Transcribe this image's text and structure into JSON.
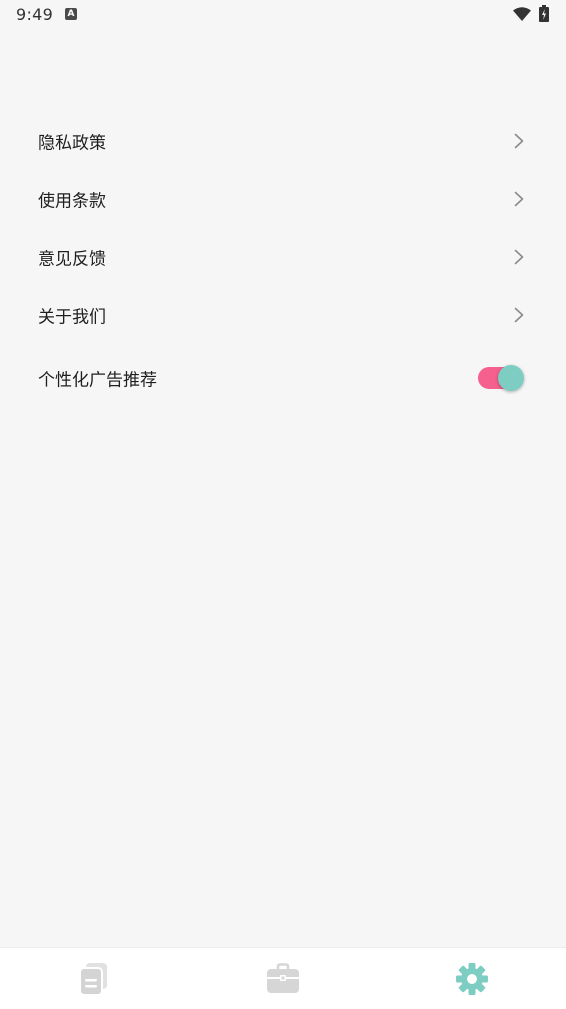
{
  "status_bar": {
    "time": "9:49",
    "notification_icon_letter": "A"
  },
  "settings": {
    "items": [
      {
        "label": "隐私政策",
        "type": "link"
      },
      {
        "label": "使用条款",
        "type": "link"
      },
      {
        "label": "意见反馈",
        "type": "link"
      },
      {
        "label": "关于我们",
        "type": "link"
      }
    ],
    "toggle": {
      "label": "个性化广告推荐",
      "enabled": true
    }
  },
  "bottom_nav": {
    "tabs": [
      {
        "icon": "documents-icon",
        "active": false
      },
      {
        "icon": "briefcase-icon",
        "active": false
      },
      {
        "icon": "gear-icon",
        "active": true
      }
    ]
  },
  "colors": {
    "background": "#f6f6f6",
    "accent_teal": "#7ecdc3",
    "toggle_track_pink": "#f5608e",
    "inactive_icon": "#d6d6d6"
  }
}
